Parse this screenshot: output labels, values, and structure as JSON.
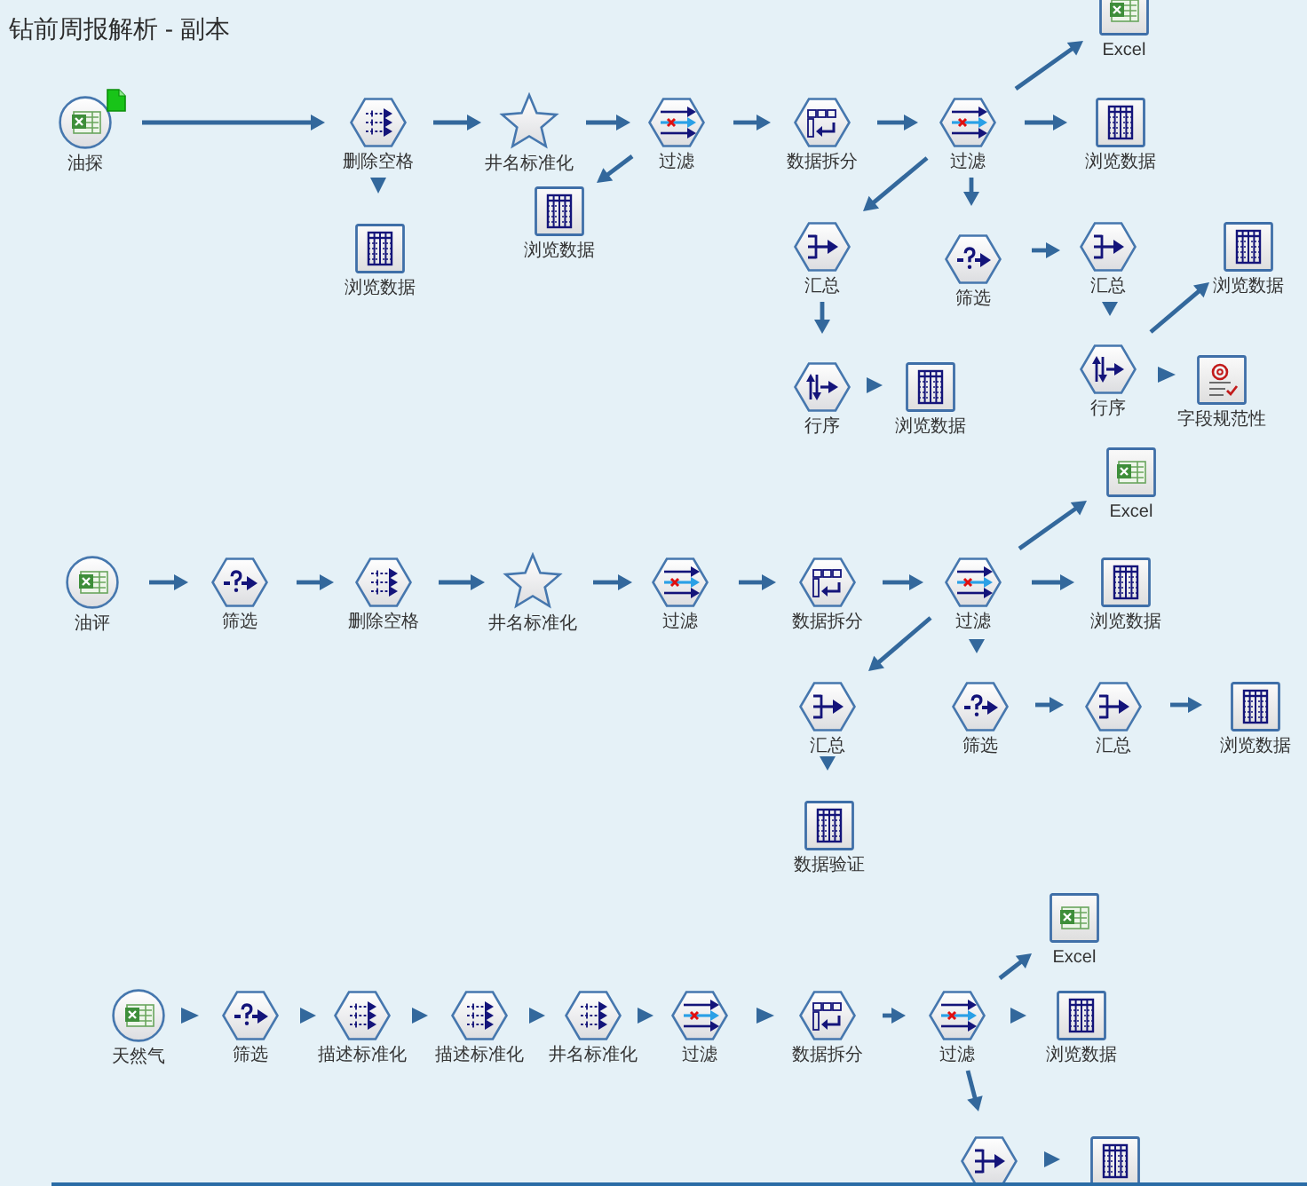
{
  "title": "钻前周报解析 - 副本",
  "streams": [
    {
      "nodes": [
        {
          "label": "油探",
          "kind": "source",
          "cached": true
        },
        {
          "label": "删除空格",
          "kind": "derive",
          "cached": false
        },
        {
          "label": "浏览数据",
          "kind": "table",
          "cached": false
        },
        {
          "label": "井名标准化",
          "kind": "star",
          "cached": false
        },
        {
          "label": "浏览数据",
          "kind": "table",
          "cached": false
        },
        {
          "label": "过滤",
          "kind": "filter",
          "cached": false
        },
        {
          "label": "数据拆分",
          "kind": "partition",
          "cached": false
        },
        {
          "label": "过滤",
          "kind": "filter",
          "cached": false
        },
        {
          "label": "Excel",
          "kind": "excel",
          "cached": false
        },
        {
          "label": "浏览数据",
          "kind": "table",
          "cached": false
        },
        {
          "label": "汇总",
          "kind": "aggregate",
          "cached": false
        },
        {
          "label": "行序",
          "kind": "sort",
          "cached": false
        },
        {
          "label": "浏览数据",
          "kind": "table",
          "cached": false
        },
        {
          "label": "筛选",
          "kind": "select",
          "cached": false
        },
        {
          "label": "汇总",
          "kind": "aggregate",
          "cached": false
        },
        {
          "label": "行序",
          "kind": "sort",
          "cached": false
        },
        {
          "label": "浏览数据",
          "kind": "table",
          "cached": false
        },
        {
          "label": "字段规范性",
          "kind": "quality",
          "cached": false
        }
      ]
    },
    {
      "nodes": [
        {
          "label": "油评",
          "kind": "source",
          "cached": false
        },
        {
          "label": "筛选",
          "kind": "select",
          "cached": false
        },
        {
          "label": "删除空格",
          "kind": "derive",
          "cached": false
        },
        {
          "label": "井名标准化",
          "kind": "star",
          "cached": false
        },
        {
          "label": "过滤",
          "kind": "filter",
          "cached": false
        },
        {
          "label": "数据拆分",
          "kind": "partition",
          "cached": false
        },
        {
          "label": "过滤",
          "kind": "filter",
          "cached": false
        },
        {
          "label": "Excel",
          "kind": "excel",
          "cached": false
        },
        {
          "label": "浏览数据",
          "kind": "table",
          "cached": false
        },
        {
          "label": "汇总",
          "kind": "aggregate",
          "cached": false
        },
        {
          "label": "数据验证",
          "kind": "table",
          "cached": false
        },
        {
          "label": "筛选",
          "kind": "select",
          "cached": false
        },
        {
          "label": "汇总",
          "kind": "aggregate",
          "cached": false
        },
        {
          "label": "浏览数据",
          "kind": "table",
          "cached": false
        }
      ]
    },
    {
      "nodes": [
        {
          "label": "天然气",
          "kind": "source",
          "cached": false
        },
        {
          "label": "筛选",
          "kind": "select",
          "cached": false
        },
        {
          "label": "描述标准化",
          "kind": "derive",
          "cached": false
        },
        {
          "label": "描述标准化",
          "kind": "derive",
          "cached": false
        },
        {
          "label": "井名标准化",
          "kind": "derive",
          "cached": false
        },
        {
          "label": "过滤",
          "kind": "filter",
          "cached": false
        },
        {
          "label": "数据拆分",
          "kind": "partition",
          "cached": false
        },
        {
          "label": "过滤",
          "kind": "filter",
          "cached": false
        },
        {
          "label": "Excel",
          "kind": "excel",
          "cached": false
        },
        {
          "label": "浏览数据",
          "kind": "table",
          "cached": false
        },
        {
          "kind": "aggregate",
          "cached": false
        },
        {
          "kind": "table",
          "cached": false
        }
      ]
    }
  ]
}
